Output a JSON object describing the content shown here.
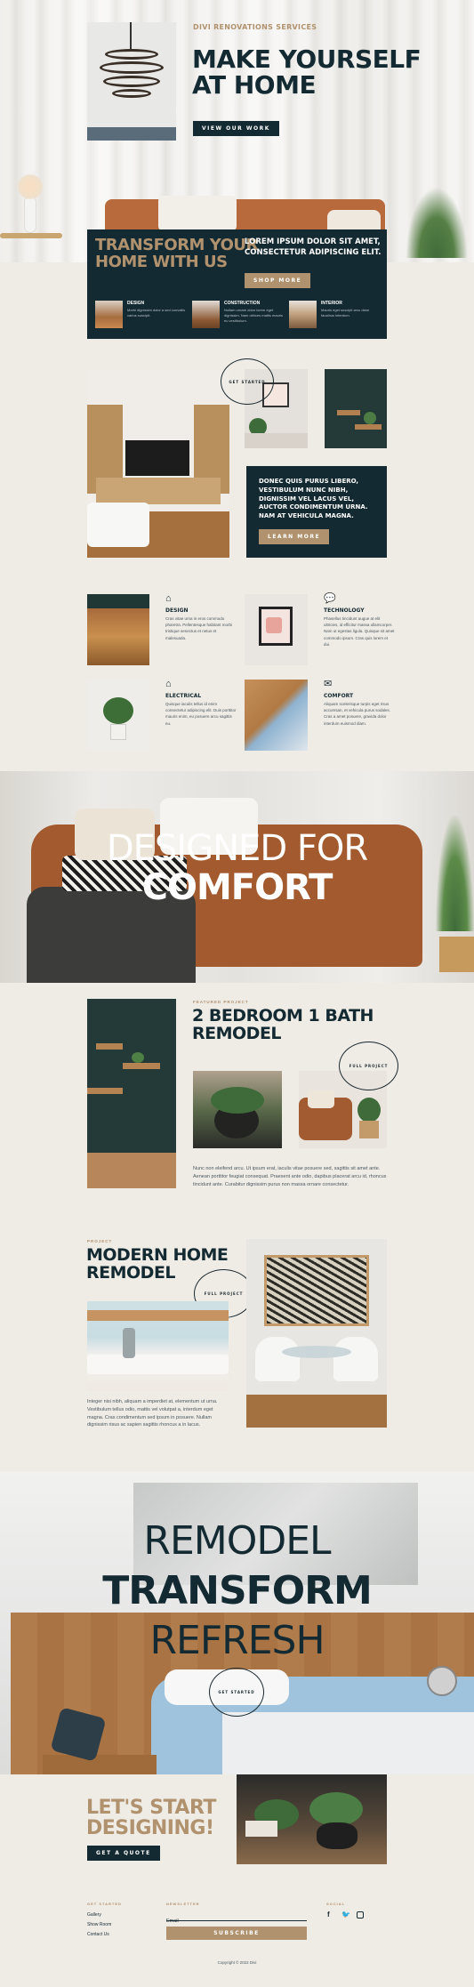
{
  "hero": {
    "eyebrow": "DIVI RENOVATIONS SERVICES",
    "title_line1": "MAKE YOURSELF",
    "title_line2": "AT HOME",
    "button": "VIEW OUR WORK"
  },
  "transform": {
    "title_line1": "TRANSFORM YOUR",
    "title_line2": "HOME WITH US",
    "headline_line1": "LOREM IPSUM DOLOR SIT AMET,",
    "headline_line2": "CONSECTETUR ADIPISCING ELIT.",
    "button": "SHOP MORE",
    "cards": [
      {
        "title": "DESIGN",
        "text": "Morbi dignissim dolor a sed convallis varius suscipit."
      },
      {
        "title": "CONSTRUCTION",
        "text": "Nullam ornare dolor lorem eget dignissim. Nam ultrices mattis mauris eu vestibulum."
      },
      {
        "title": "INTERIOR",
        "text": "Mauris eget suscipit arcu diam faucibus interdum."
      }
    ]
  },
  "gallery": {
    "circle_label": "GET STARTED",
    "dark_text": "DONEC QUIS PURUS LIBERO, VESTIBULUM NUNC NIBH, DIGNISSIM VEL LACUS VEL, AUCTOR CONDIMENTUM URNA. NAM AT VEHICULA MAGNA.",
    "button": "LEARN MORE"
  },
  "services": [
    {
      "icon": "home-icon",
      "title": "DESIGN",
      "text": "Cras vitae urna in eros commodo pharetra. Pellentesque habitant morbi tristique senectus et netus et malesuada."
    },
    {
      "icon": "chat-icon",
      "title": "TECHNOLOGY",
      "text": "Phasellus tincidunt augue at elit ultricies, id efficitur massa ullamcorper. Nam ut egestas ligula. Quisque sit amet commodo ipsum. Cras quis lorem et dui."
    },
    {
      "icon": "house-icon",
      "title": "ELECTRICAL",
      "text": "Quisque iaculis tellus id enim consectetur adipiscing elit. Duis porttitor mauris enim, eu posuere arcu sagittis eu."
    },
    {
      "icon": "mail-icon",
      "title": "COMFORT",
      "text": "Aliquam scelerisque turpis eget risus accumsan, et vehicula purus sodales. Cras a amet posuere, gravida dolor interdum euismod diam."
    }
  ],
  "comfort": {
    "line1": "DESIGNED FOR",
    "line2": "COMFORT"
  },
  "project1": {
    "eyebrow": "FEATURED PROJECT",
    "title_line1": "2 BEDROOM 1 BATH",
    "title_line2": "REMODEL",
    "circle_label": "FULL PROJECT",
    "text": "Nunc non eleifend arcu. Ut ipsum erat, iaculis vitae posuere sed, sagittis sit amet ante. Aenean porttitor feugiat consequat. Praesent ante odio, dapibus placerat arcu id, rhoncus tincidunt ante. Curabitur dignissim purus non massa ornare consectetur."
  },
  "project2": {
    "eyebrow": "PROJECT",
    "title_line1": "MODERN HOME",
    "title_line2": "REMODEL",
    "circle_label": "FULL PROJECT",
    "text": "Integer nisi nibh, aliquam a imperdiet at, elementum ut urna. Vestibulum tellus odio, mattis vel volutpat a, interdum eget magna. Cras condimentum sed ipsum in posuere. Nullam dignissim risus ac sapien sagittis rhoncus a in lacus."
  },
  "banner": {
    "line1": "REMODEL",
    "line2": "TRANSFORM",
    "line3": "REFRESH",
    "circle_label": "GET STARTED"
  },
  "cta": {
    "title_line1": "LET'S START",
    "title_line2": "DESIGNING!",
    "button": "GET A QUOTE"
  },
  "footer": {
    "col1_title": "GET STARTED",
    "links": [
      "Gallery",
      "Show Room",
      "Contact Us"
    ],
    "newsletter_title": "NEWSLETTER",
    "email_placeholder": "Email",
    "subscribe": "SUBSCRIBE",
    "social_title": "SOCIAL",
    "copyright": "Copyright © 2022 Divi"
  },
  "colors": {
    "navy": "#142a32",
    "tan": "#b1926e",
    "cream": "#efebe5"
  }
}
